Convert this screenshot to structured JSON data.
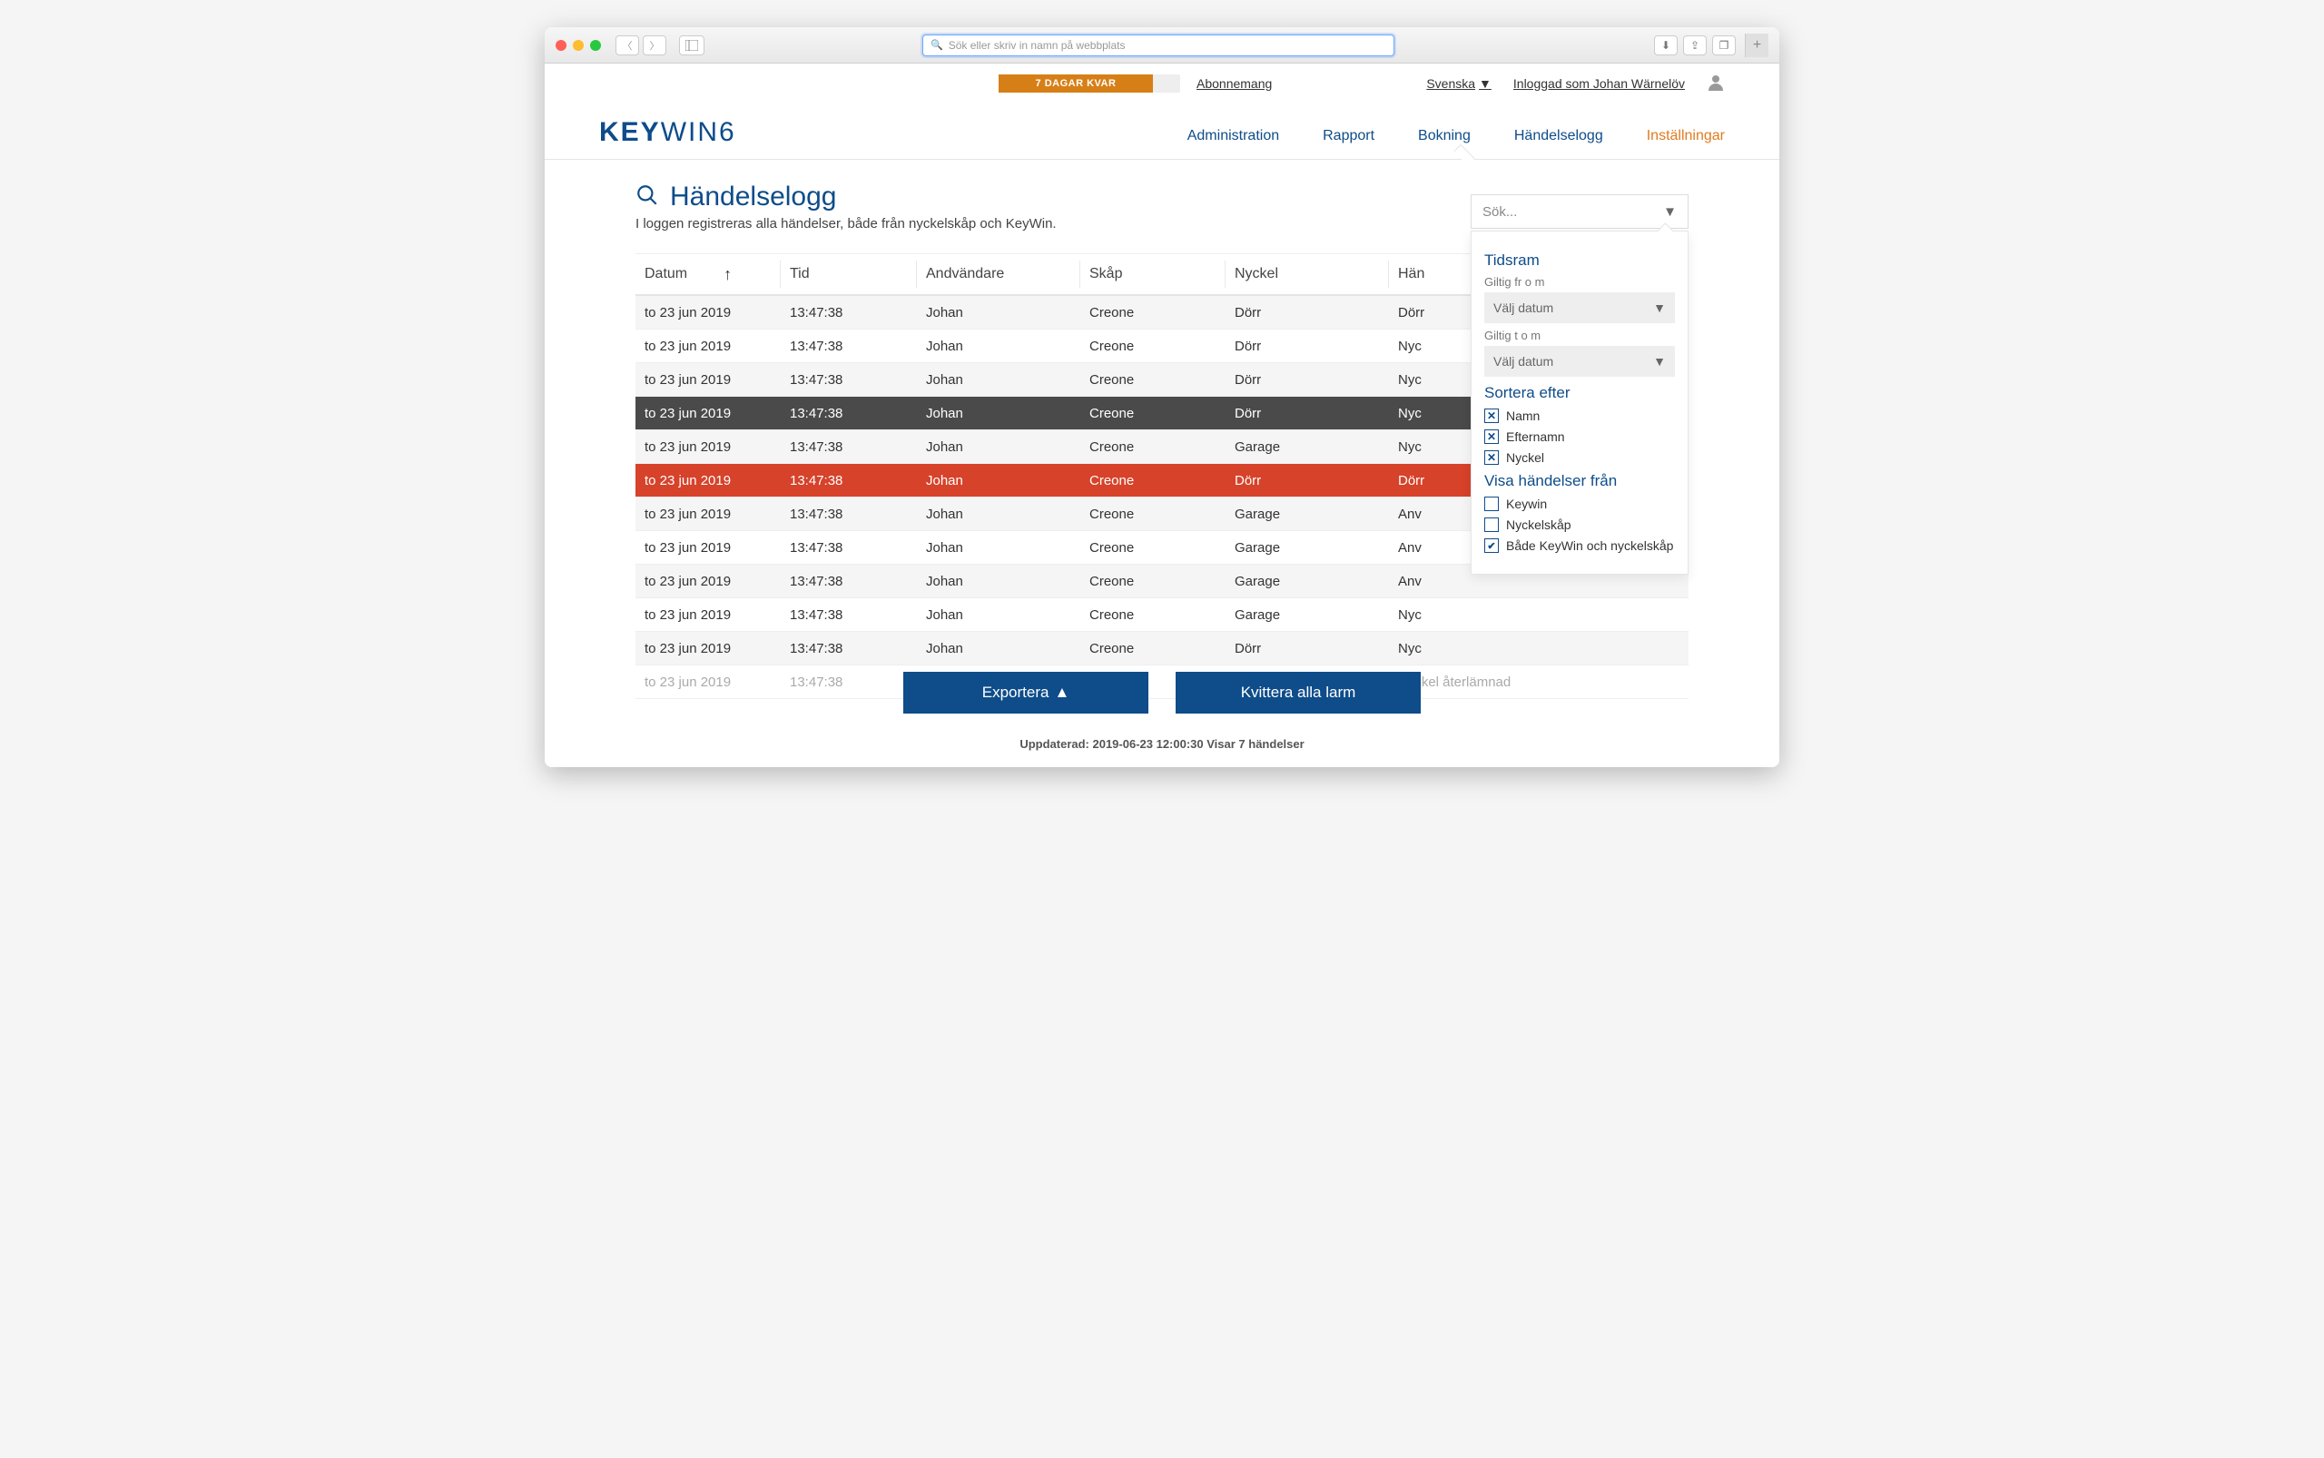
{
  "browser": {
    "url_placeholder": "Sök eller skriv in namn på webbplats"
  },
  "topbar": {
    "trial_text": "7 DAGAR KVAR",
    "subscription": "Abonnemang",
    "language": "Svenska",
    "logged_in": "Inloggad som Johan Wärnelöv"
  },
  "logo": {
    "bold": "KEY",
    "rest": "WIN6"
  },
  "nav": {
    "items": [
      "Administration",
      "Rapport",
      "Bokning",
      "Händelselogg",
      "Inställningar"
    ]
  },
  "page": {
    "title": "Händelselogg",
    "subtitle": "I loggen registreras alla händelser, både från nyckelskåp och KeyWin."
  },
  "search": {
    "placeholder": "Sök..."
  },
  "table": {
    "headers": {
      "date": "Datum",
      "time": "Tid",
      "user": "Andvändare",
      "cabinet": "Skåp",
      "key": "Nyckel",
      "event": "Hän"
    },
    "rows": [
      {
        "date": "to 23 jun 2019",
        "time": "13:47:38",
        "user": "Johan",
        "cabinet": "Creone",
        "key": "Dörr",
        "event": "Dörr",
        "cls": "alt"
      },
      {
        "date": "to 23 jun 2019",
        "time": "13:47:38",
        "user": "Johan",
        "cabinet": "Creone",
        "key": "Dörr",
        "event": "Nyc",
        "cls": ""
      },
      {
        "date": "to 23 jun 2019",
        "time": "13:47:38",
        "user": "Johan",
        "cabinet": "Creone",
        "key": "Dörr",
        "event": "Nyc",
        "cls": "alt"
      },
      {
        "date": "to 23 jun 2019",
        "time": "13:47:38",
        "user": "Johan",
        "cabinet": "Creone",
        "key": "Dörr",
        "event": "Nyc",
        "cls": "darkrow"
      },
      {
        "date": "to 23 jun 2019",
        "time": "13:47:38",
        "user": "Johan",
        "cabinet": "Creone",
        "key": "Garage",
        "event": "Nyc",
        "cls": "alt"
      },
      {
        "date": "to 23 jun 2019",
        "time": "13:47:38",
        "user": "Johan",
        "cabinet": "Creone",
        "key": "Dörr",
        "event": "Dörr",
        "cls": "redrow"
      },
      {
        "date": "to 23 jun 2019",
        "time": "13:47:38",
        "user": "Johan",
        "cabinet": "Creone",
        "key": "Garage",
        "event": "Anv",
        "cls": "alt"
      },
      {
        "date": "to 23 jun 2019",
        "time": "13:47:38",
        "user": "Johan",
        "cabinet": "Creone",
        "key": "Garage",
        "event": "Anv",
        "cls": ""
      },
      {
        "date": "to 23 jun 2019",
        "time": "13:47:38",
        "user": "Johan",
        "cabinet": "Creone",
        "key": "Garage",
        "event": "Anv",
        "cls": "alt"
      },
      {
        "date": "to 23 jun 2019",
        "time": "13:47:38",
        "user": "Johan",
        "cabinet": "Creone",
        "key": "Garage",
        "event": "Nyc",
        "cls": ""
      },
      {
        "date": "to 23 jun 2019",
        "time": "13:47:38",
        "user": "Johan",
        "cabinet": "Creone",
        "key": "Dörr",
        "event": "Nyc",
        "cls": "alt"
      },
      {
        "date": "to 23 jun 2019",
        "time": "13:47:38",
        "user": "",
        "cabinet": "",
        "key": "",
        "event": "Nyckel återlämnad",
        "cls": "faded"
      }
    ]
  },
  "filter": {
    "timeframe_title": "Tidsram",
    "from_label": "Giltig fr o m",
    "to_label": "Giltig t o m",
    "date_placeholder": "Välj datum",
    "sort_title": "Sortera efter",
    "sort_options": [
      "Namn",
      "Efternamn",
      "Nyckel"
    ],
    "show_title": "Visa händelser från",
    "show_options": [
      {
        "label": "Keywin",
        "checked": false
      },
      {
        "label": "Nyckelskåp",
        "checked": false
      },
      {
        "label": "Både KeyWin och nyckelskåp",
        "checked": true
      }
    ]
  },
  "actions": {
    "export": "Exportera",
    "ack": "Kvittera alla larm"
  },
  "footer": "Uppdaterad: 2019-06-23 12:00:30 Visar 7 händelser"
}
